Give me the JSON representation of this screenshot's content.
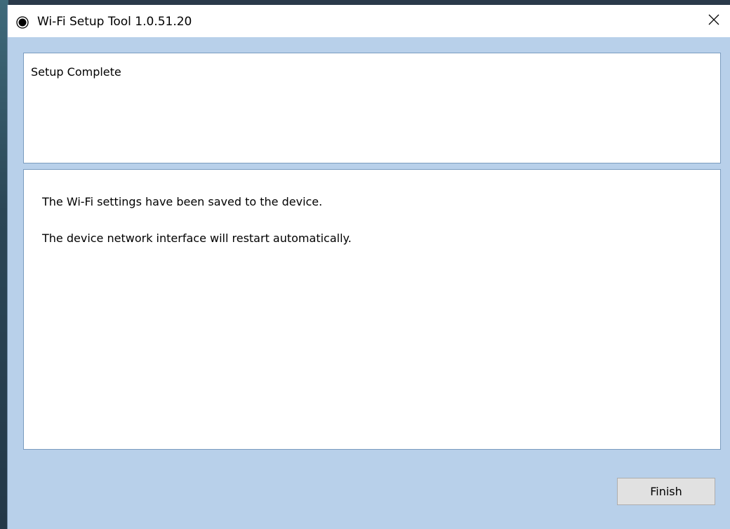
{
  "window": {
    "title": "Wi-Fi Setup Tool 1.0.51.20",
    "icon": "app-icon",
    "close_icon": "close-icon"
  },
  "header": {
    "title": "Setup Complete"
  },
  "content": {
    "messages": [
      "The Wi-Fi settings have been saved to the device.",
      "The device network interface will restart automatically."
    ]
  },
  "footer": {
    "finish_label": "Finish"
  },
  "colors": {
    "window_background": "#b8d0ea",
    "panel_border": "#7a9cbf",
    "button_background": "#e1e1e1"
  }
}
